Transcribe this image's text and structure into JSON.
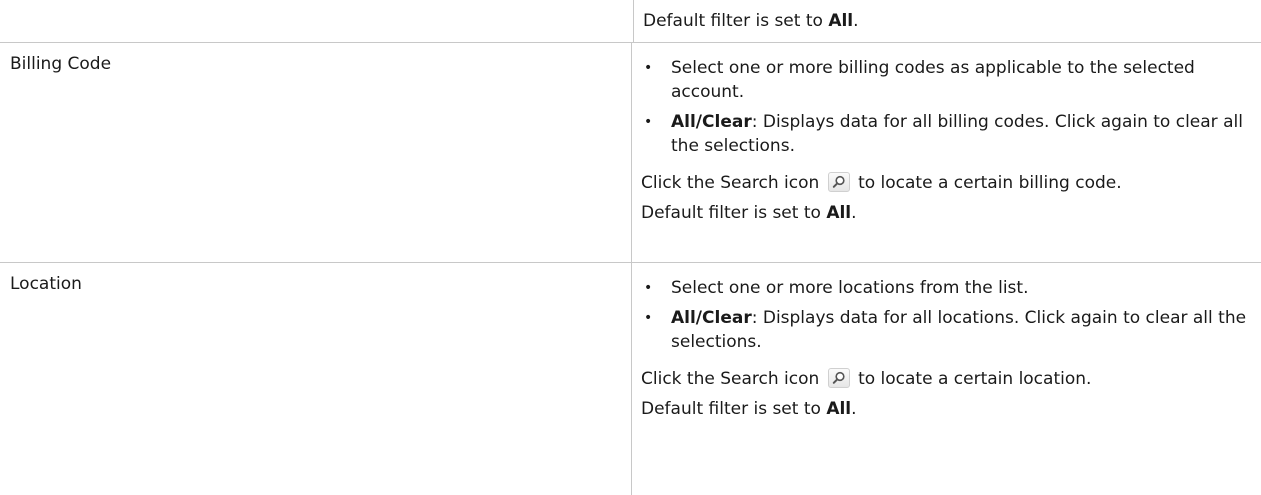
{
  "rows": [
    {
      "label": "",
      "default_text": "Default filter is set to ",
      "default_value": "All",
      "default_end": "."
    },
    {
      "label": "Billing Code",
      "bullets": [
        {
          "bold": "",
          "text": "Select one or more billing codes as applicable to the selected account."
        },
        {
          "bold": "All/Clear",
          "text": ": Displays data for all billing codes. Click again to clear all the selections."
        }
      ],
      "search_before": "Click the Search icon",
      "search_after": "to locate a certain billing code.",
      "default_text": "Default filter is set to ",
      "default_value": "All",
      "default_end": "."
    },
    {
      "label": "Location",
      "bullets": [
        {
          "bold": "",
          "text": "Select one or more locations from the list."
        },
        {
          "bold": "All/Clear",
          "text": ": Displays data for all locations. Click again to clear all the selections."
        }
      ],
      "search_before": "Click the Search icon",
      "search_after": "to locate a certain location.",
      "default_text": "Default filter is set to ",
      "default_value": "All",
      "default_end": "."
    }
  ],
  "icons": {
    "search": "search-icon"
  },
  "colors": {
    "border": "#c8c8c8",
    "text": "#1a1a1a"
  }
}
